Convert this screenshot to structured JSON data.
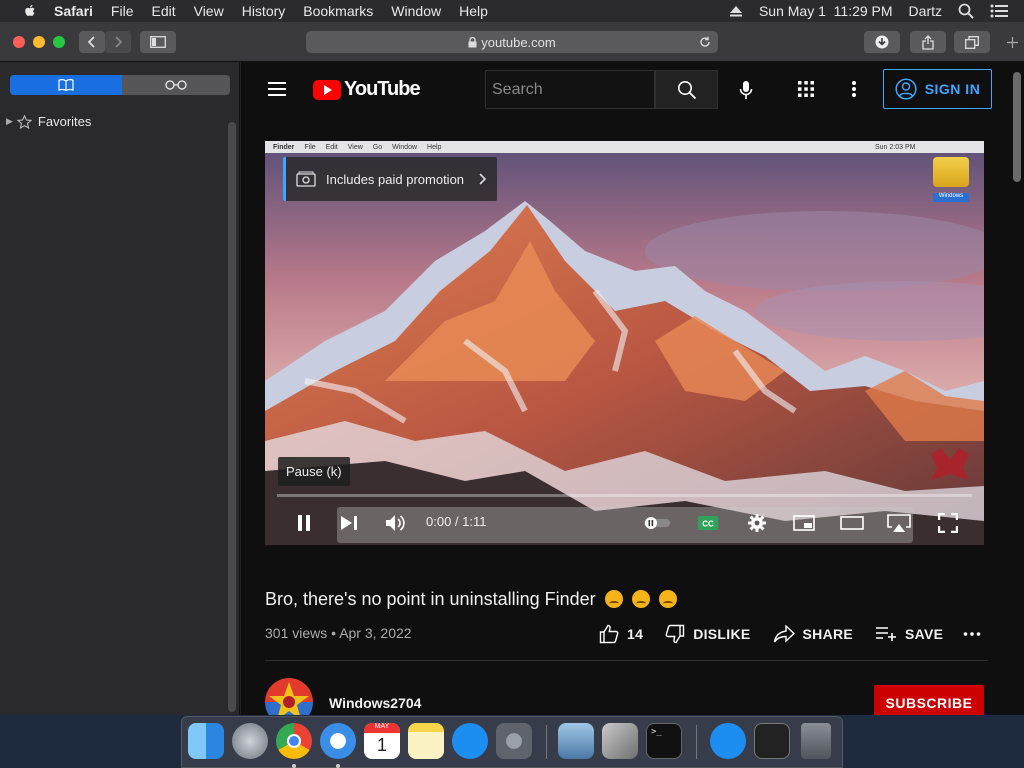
{
  "menubar": {
    "app": "Safari",
    "items": [
      "File",
      "Edit",
      "View",
      "History",
      "Bookmarks",
      "Window",
      "Help"
    ],
    "clock": "Sun May 1  11:29 PM",
    "user": "Dartz"
  },
  "browser": {
    "url": "youtube.com",
    "sidebar": {
      "favorites_label": "Favorites"
    }
  },
  "youtube": {
    "logo_text": "YouTube",
    "search_placeholder": "Search",
    "sign_in": "SIGN IN",
    "player": {
      "promo_text": "Includes paid promotion",
      "pause_tooltip": "Pause (k)",
      "time": "0:00 / 1:11",
      "progress": 0.0,
      "mini_menubar": [
        "Finder",
        "File",
        "Edit",
        "View",
        "Go",
        "Window",
        "Help"
      ],
      "mini_clock": "Sun 2:03 PM",
      "drive_label": "Windows"
    },
    "video": {
      "title": "Bro, there's no point in uninstalling Finder",
      "views": "301 views",
      "date": "Apr 3, 2022",
      "like_count": "14",
      "dislike": "DISLIKE",
      "share": "SHARE",
      "save": "SAVE"
    },
    "channel": {
      "name": "Windows2704",
      "subscribe": "SUBSCRIBE"
    }
  },
  "dock": {
    "apps": [
      "finder-icon",
      "launchpad-icon",
      "chrome-icon",
      "safari-icon",
      "calendar-icon",
      "notes-icon",
      "app-store-icon",
      "system-preferences-icon",
      "preview-icon",
      "utilities-icon",
      "terminal-icon",
      "app-store-download-icon",
      "game-icon",
      "trash-icon"
    ],
    "calendar_month": "MAY",
    "calendar_day": "1"
  },
  "colors": {
    "accent": "#3ea6ff",
    "youtube_red": "#ff0000",
    "subscribe_red": "#cc0000",
    "safari_blue": "#1a6fe0"
  }
}
